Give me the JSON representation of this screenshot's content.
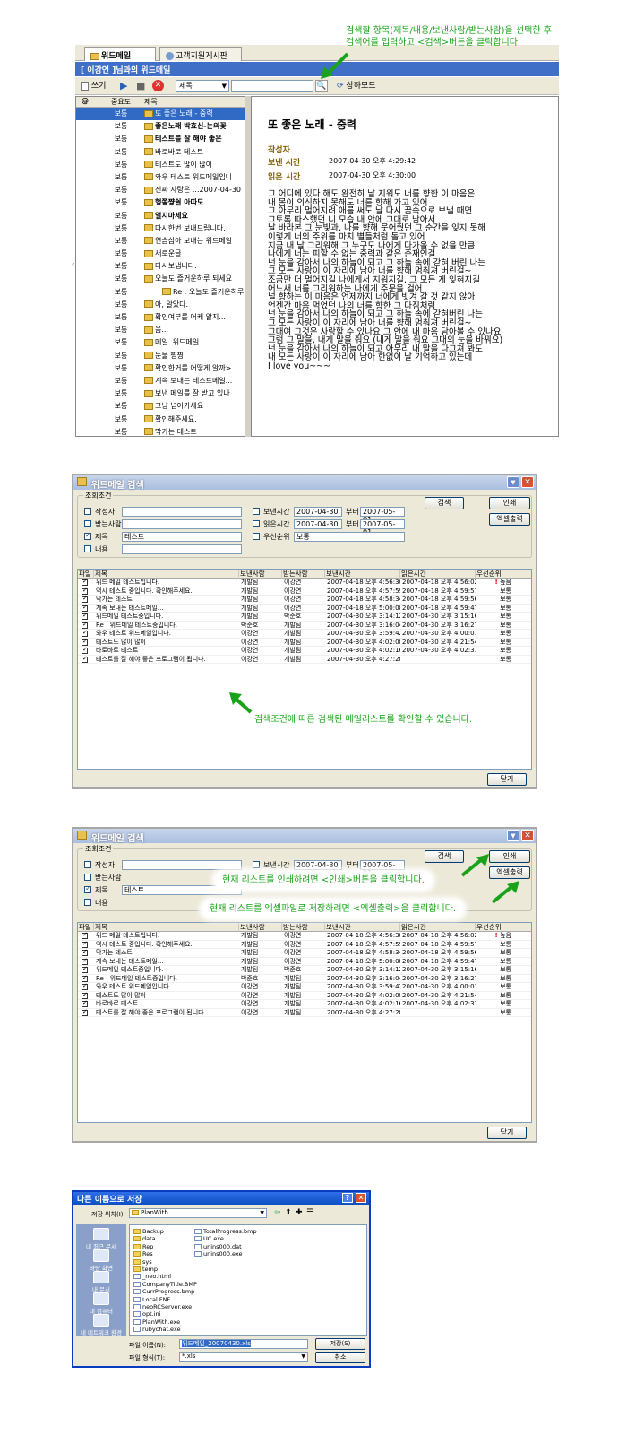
{
  "s1": {
    "tabs": [
      "위드메일",
      "고객지원게시판"
    ],
    "title": "[ 이강연 ]님과의 위드메일",
    "toolbar": {
      "write": "쓰기",
      "field": "제목",
      "mode": "상하모드"
    },
    "list_header": {
      "imp": "중요도",
      "subj": "제목"
    },
    "rows": [
      {
        "imp": "보통",
        "subj": "또 좋은 노래 - 중력"
      },
      {
        "imp": "보통",
        "subj": "좋은노래 박효신-눈의꽃"
      },
      {
        "imp": "보통",
        "subj": "테스트를 잘 해야 좋은"
      },
      {
        "imp": "보통",
        "subj": "바로바로 테스트"
      },
      {
        "imp": "보통",
        "subj": "테스트도 많이 많이"
      },
      {
        "imp": "보통",
        "subj": "와우 테스트 위드메일입니"
      },
      {
        "imp": "보통",
        "subj": "진짜 사랑은 ...2007-04-30"
      },
      {
        "imp": "보통",
        "subj": "행쫑쨩쉴 아따도"
      },
      {
        "imp": "보통",
        "subj": "열지마세요"
      },
      {
        "imp": "보통",
        "subj": "다시한번 보내드립니다."
      },
      {
        "imp": "보통",
        "subj": "연습삼아 보내는 위드메일"
      },
      {
        "imp": "보통",
        "subj": "새로운글"
      },
      {
        "imp": "보통",
        "subj": "다시보냅니다."
      },
      {
        "imp": "보통",
        "subj": "오늘도 즐거운하루 되세요"
      },
      {
        "imp": "보통",
        "subj": "Re : 오늘도 즐거운하루"
      },
      {
        "imp": "보통",
        "subj": "아, 알았다."
      },
      {
        "imp": "보통",
        "subj": "확인여부를 어케 알지..."
      },
      {
        "imp": "보통",
        "subj": "음..."
      },
      {
        "imp": "보통",
        "subj": "메일..위드메일"
      },
      {
        "imp": "보통",
        "subj": "눈물 찡찡"
      },
      {
        "imp": "보통",
        "subj": "확인한거를 어떻게 알까>"
      },
      {
        "imp": "보통",
        "subj": "계속 보내는 테스트메일..."
      },
      {
        "imp": "보통",
        "subj": "보낸 메일를 잘 받고 있나"
      },
      {
        "imp": "보통",
        "subj": "그냥 넘어가세요"
      },
      {
        "imp": "보통",
        "subj": "확인해주세요."
      },
      {
        "imp": "보통",
        "subj": "막가는 테스트"
      }
    ],
    "view": {
      "subject": "또 좋은 노래 - 중력",
      "author_label": "작성자",
      "sent_label": "보낸 시간",
      "sent_value": "2007-04-30 오후 4:29:42",
      "read_label": "읽은 시간",
      "read_value": "2007-04-30 오후 4:30:00",
      "body": "그 어디에 있다 해도 완전히 날 지워도 너를 향한 이 마음은\n내 몸이 의식하지 못해도 너를 향해 가고 있어\n그 아무리 멀어지려 애를 써도 날 다시 꿈속으로 보낼 때면\n그토록 따스했던 니 모습 내 안에 그대로 남아서\n날 바라본 그 눈빛과, 나를 향해 웃어줬던 그 순간을 잊지 못해\n이렇게 너의 주위를 마치 별들처럼 돌고 있어\n지금 내 날 그리워해 그 누구도 나에게 다가올 수 없을 만큼\n나에게 너는 피할 수 없는 중력과 같은 존재인걸\n넌 눈을 감아서 나의 하늘이 되고 그 하늘 속에 갇혀 버린 나는\n그 모든 사랑이 이 자리에 남아 너를 향해 멈춰져 버린걸~\n조금만 더 멀어지길 나에게서 지워지길, 그 모든 게 잊혀지길\n어느새 너를 그리워하는 나에게 주문을 걸어\n널 향하는 이 마음은 언제까지 너에게 빗겨 갈 것 같지 않아\n언젠간 마음 먹었던 나의 너를 향한 그 다짐처럼\n넌 눈을 감아서 나의 하늘이 되고 그 하늘 속에 갇혀버린 나는\n그 모든 사랑이 이 자리에 남아 너를 향해 멈춰져 버린걸~\n그대여 그것은 사랑할 수 있나요 그 안에 내 마음 담아볼 수 있나요\n그럼 그 말을, 내게 말을 줘요 (내게 말을 줘요 그대의 눈을 바꿔요)\n넌 눈을 감아서 나의 하늘이 되고 아무리 내 말을 다그쳐 봐도\n내 모든 사랑이 이 자리에 남아 한없이 날 기억하고 있는데\nI love you~~~"
    },
    "annotation": "검색할 항목(제목/내용/보낸사람/받는사람)을 선택한 후\n검색어를 입력하고 <검색>버튼을 클릭합니다."
  },
  "search": {
    "title": "위드메일 검색",
    "legend": "조회조건",
    "fields": {
      "author": "작성자",
      "receiver": "받는사람",
      "subject": "제목",
      "content": "내용",
      "subject_value": "테스트",
      "sent_time": "보낸시간",
      "read_time": "읽은시간",
      "priority": "우선순위",
      "from": "부터",
      "date_a": "2007-04-30",
      "date_b": "2007-05-01",
      "priority_value": "보통"
    },
    "buttons": {
      "search": "검색",
      "print": "인쇄",
      "excel": "엑셀출력",
      "close": "닫기"
    },
    "columns": [
      "파일",
      "제목",
      "보낸사람",
      "받는사람",
      "보낸시간",
      "읽은시간",
      "우선순위"
    ],
    "rows": [
      {
        "subj": "위드 메일 테스트입니다.",
        "from": "개발팀",
        "to": "이강연",
        "sent": "2007-04-18 오후 4:56:30",
        "read": "2007-04-18 오후 4:56:02",
        "pri": "높음",
        "urgent": true
      },
      {
        "subj": "역시 테스트 중입니다. 확인해주세요.",
        "from": "개발팀",
        "to": "이강연",
        "sent": "2007-04-18 오후 4:57:59",
        "read": "2007-04-18 오후 4:59:57",
        "pri": "보통"
      },
      {
        "subj": "막가는 테스트",
        "from": "개발팀",
        "to": "이강연",
        "sent": "2007-04-18 오후 4:58:34",
        "read": "2007-04-18 오후 4:59:56",
        "pri": "보통"
      },
      {
        "subj": "계속 보내는 테스트메일...",
        "from": "개발팀",
        "to": "이강연",
        "sent": "2007-04-18 오후 5:00:08",
        "read": "2007-04-18 오후 4:59:47",
        "pri": "보통"
      },
      {
        "subj": "위드메일 테스트중입니다.",
        "from": "개발팀",
        "to": "박준호",
        "sent": "2007-04-30 오후 3:14:12",
        "read": "2007-04-30 오후 3:15:16",
        "pri": "보통"
      },
      {
        "subj": "Re : 위드메일 테스트중입니다.",
        "from": "박준호",
        "to": "개발팀",
        "sent": "2007-04-30 오후 3:16:04",
        "read": "2007-04-30 오후 3:16:27",
        "pri": "보통"
      },
      {
        "subj": "와우 테스트 위드메일입니다.",
        "from": "이강연",
        "to": "개발팀",
        "sent": "2007-04-30 오후 3:59:42",
        "read": "2007-04-30 오후 4:00:01",
        "pri": "보통"
      },
      {
        "subj": "테스트도 많이 많이",
        "from": "이강연",
        "to": "개발팀",
        "sent": "2007-04-30 오후 4:02:08",
        "read": "2007-04-30 오후 4:21:54",
        "pri": "보통"
      },
      {
        "subj": "바로바로 테스트",
        "from": "이강연",
        "to": "개발팀",
        "sent": "2007-04-30 오후 4:02:16",
        "read": "2007-04-30 오후 4:02:31",
        "pri": "보통"
      },
      {
        "subj": "테스트를 잘 해야 좋은 프로그램이 됩니다.",
        "from": "이강연",
        "to": "개발팀",
        "sent": "2007-04-30 오후 4:27:28",
        "read": "",
        "pri": "보통"
      }
    ],
    "annotation": "검색조건에 따른 검색된 메일리스트를 확인할 수 있습니다."
  },
  "search2": {
    "annotation_print": "현재 리스트를  인쇄하려면 <인쇄>버튼을 클릭합니다.",
    "annotation_excel": "현재 리스트를 엑셀파일로 저장하려면 <엑셀출력>을 클릭합니다."
  },
  "save": {
    "title": "다른 이름으로 저장",
    "location_label": "저장 위치(I):",
    "location": "PlanWith",
    "places": [
      "내 최근 문서",
      "바탕 화면",
      "내 문서",
      "내 컴퓨터",
      "내 네트워크 환경"
    ],
    "files_col1": [
      "Backup",
      "data",
      "Rep",
      "Res",
      "sys",
      "temp",
      "_neo.html",
      "CompanyTitle.BMP",
      "CurrProgress.bmp",
      "Local.FNF",
      "neoRCServer.exe",
      "opt.ini",
      "PlanWith.exe",
      "rubychat.exe"
    ],
    "files_col2": [
      "TotalProgress.bmp",
      "UC.exe",
      "unins000.dat",
      "unins000.exe"
    ],
    "filename_label": "파일 이름(N):",
    "filename": "위드메일_20070430.xls",
    "filetype_label": "파일 형식(T):",
    "filetype": "*.xls",
    "save_btn": "저장(S)",
    "cancel_btn": "취소"
  },
  "colors": {
    "accent": "#316ac5",
    "annotation": "#1aa31a",
    "titlebar": "#3f6fc7"
  }
}
